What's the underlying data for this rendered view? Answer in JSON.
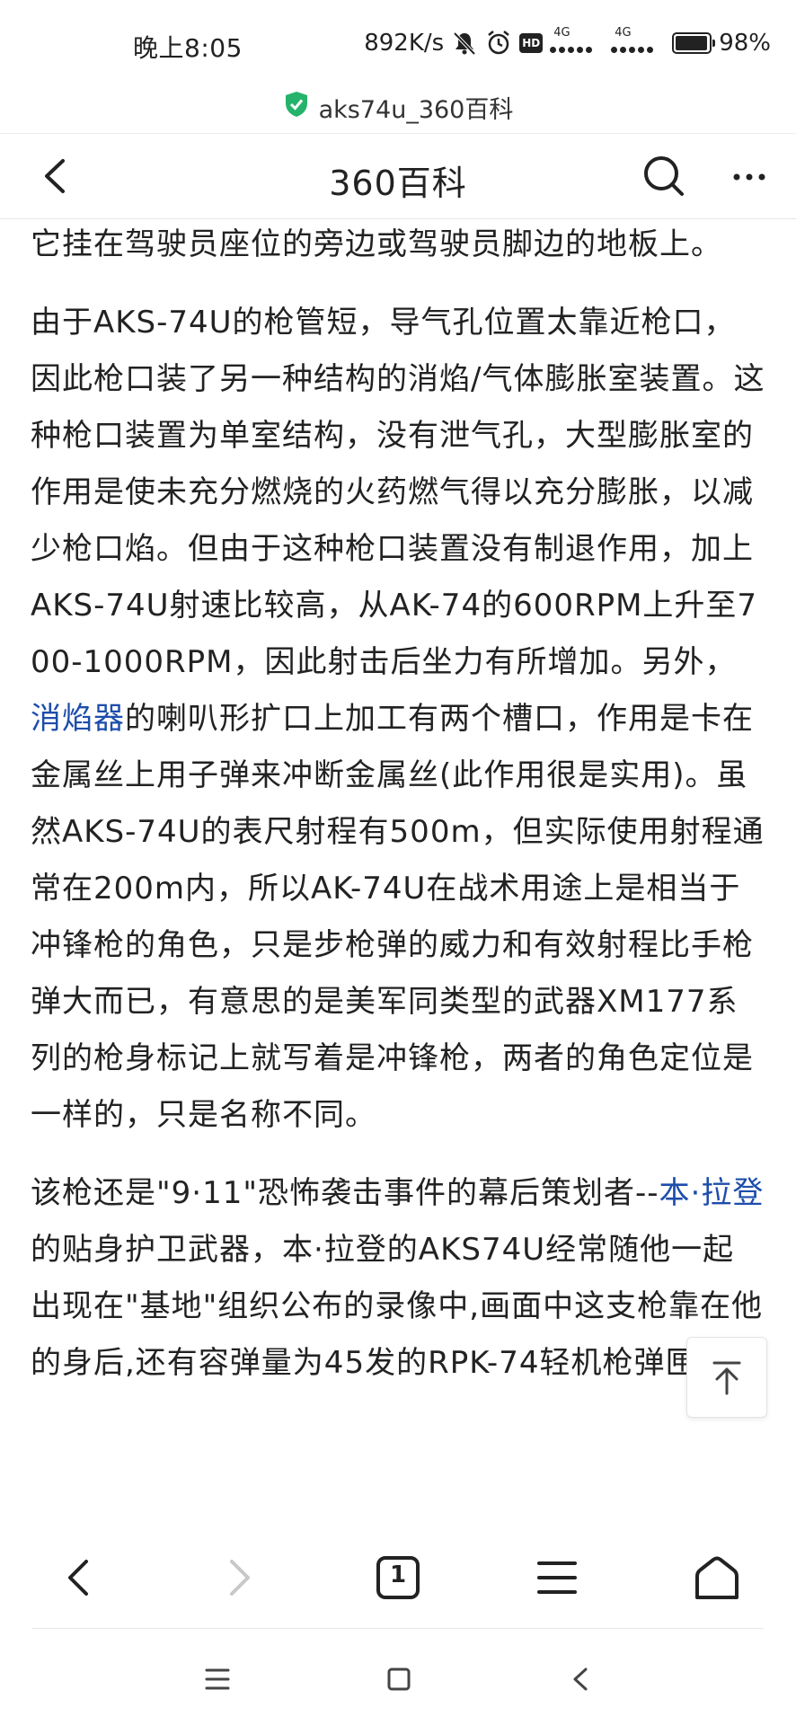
{
  "status_bar": {
    "time": "晚上8:05",
    "net_speed": "892K/s",
    "signal1_label": "4G",
    "signal2_label": "4G",
    "battery_percent": "98%",
    "battery_level": 0.98
  },
  "url_bar": {
    "url_text": "aks74u_360百科",
    "secure_icon": "shield-check-icon"
  },
  "header": {
    "title": "360百科"
  },
  "article": {
    "p1": "于人们在装甲车内使用，由于其短小，乘员们常常把它挂在驾驶员座位的旁边或驾驶员脚边的地板上。",
    "p2_before_link": "由于AKS-74U的枪管短，导气孔位置太靠近枪口，因此枪口装了另一种结构的消焰/气体膨胀室装置。这种枪口装置为单室结构，没有泄气孔，大型膨胀室的作用是使未充分燃烧的火药燃气得以充分膨胀，以减少枪口焰。但由于这种枪口装置没有制退作用，加上AKS-74U射速比较高，从AK-74的600RPM上升至700-1000RPM，因此射击后坐力有所增加。另外，",
    "p2_link": "消焰器",
    "p2_after_link": "的喇叭形扩口上加工有两个槽口，作用是卡在金属丝上用子弹来冲断金属丝(此作用很是实用)。虽然AKS-74U的表尺射程有500m，但实际使用射程通常在200m内，所以AK-74U在战术用途上是相当于冲锋枪的角色，只是步枪弹的威力和有效射程比手枪弹大而已，有意思的是美军同类型的武器XM177系列的枪身标记上就写着是冲锋枪，两者的角色定位是一样的，只是名称不同。",
    "p3_before_link": "该枪还是\"9·11\"恐怖袭击事件的幕后策划者--",
    "p3_link": "本·拉登",
    "p3_after_link": "的贴身护卫武器，本·拉登的AKS74U经常随他一起出现在\"基地\"组织公布的录像中,画面中这支枪靠在他的身后,还有容弹量为45发的RPK-74轻机枪弹匣。"
  },
  "browser_toolbar": {
    "tab_count": "1"
  },
  "colors": {
    "link": "#1d4dab",
    "shield": "#25b36b",
    "text": "#222222"
  }
}
